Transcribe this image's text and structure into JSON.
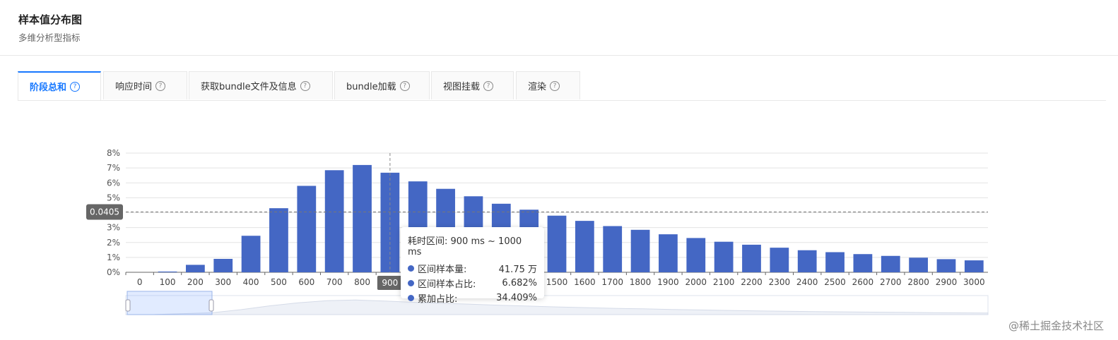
{
  "header": {
    "title": "样本值分布图",
    "subtitle": "多维分析型指标"
  },
  "tabs": [
    {
      "label": "阶段总和",
      "active": true
    },
    {
      "label": "响应时间",
      "active": false
    },
    {
      "label": "获取bundle文件及信息",
      "active": false
    },
    {
      "label": "bundle加载",
      "active": false
    },
    {
      "label": "视图挂载",
      "active": false
    },
    {
      "label": "渲染",
      "active": false
    }
  ],
  "help_icon": "question-circle-icon",
  "chart_data": {
    "type": "bar",
    "categories": [
      "0",
      "100",
      "200",
      "300",
      "400",
      "500",
      "600",
      "700",
      "800",
      "900",
      "1000",
      "1100",
      "1200",
      "1300",
      "1400",
      "1500",
      "1600",
      "1700",
      "1800",
      "1900",
      "2000",
      "2100",
      "2200",
      "2300",
      "2400",
      "2500",
      "2600",
      "2700",
      "2800",
      "2900",
      "3000"
    ],
    "series": [
      {
        "values": [
          0.0,
          0.05,
          0.5,
          0.9,
          2.45,
          4.3,
          5.8,
          6.85,
          7.2,
          6.682,
          6.1,
          5.6,
          5.1,
          4.6,
          4.2,
          3.8,
          3.45,
          3.1,
          2.85,
          2.55,
          2.3,
          2.05,
          1.85,
          1.65,
          1.48,
          1.35,
          1.22,
          1.1,
          0.98,
          0.88,
          0.8
        ],
        "color": "#4467c4"
      }
    ],
    "yticks": [
      "0%",
      "1%",
      "2%",
      "3%",
      "4%",
      "5%",
      "6%",
      "7%",
      "8%"
    ],
    "ylim": [
      0,
      8
    ],
    "grid": true,
    "crosshair": {
      "x_label": "900",
      "y_label": "0.0405"
    },
    "tooltip": {
      "title": "耗时区间: 900 ms ~ 1000 ms",
      "rows": [
        {
          "label": "区间样本量:",
          "value": "41.75 万"
        },
        {
          "label": "区间样本占比:",
          "value": "6.682%"
        },
        {
          "label": "累加占比:",
          "value": "34.409%"
        }
      ]
    }
  },
  "footer": {
    "watermark": "@稀土掘金技术社区"
  },
  "colors": {
    "accent": "#1677ff",
    "bar": "#4467c4"
  }
}
